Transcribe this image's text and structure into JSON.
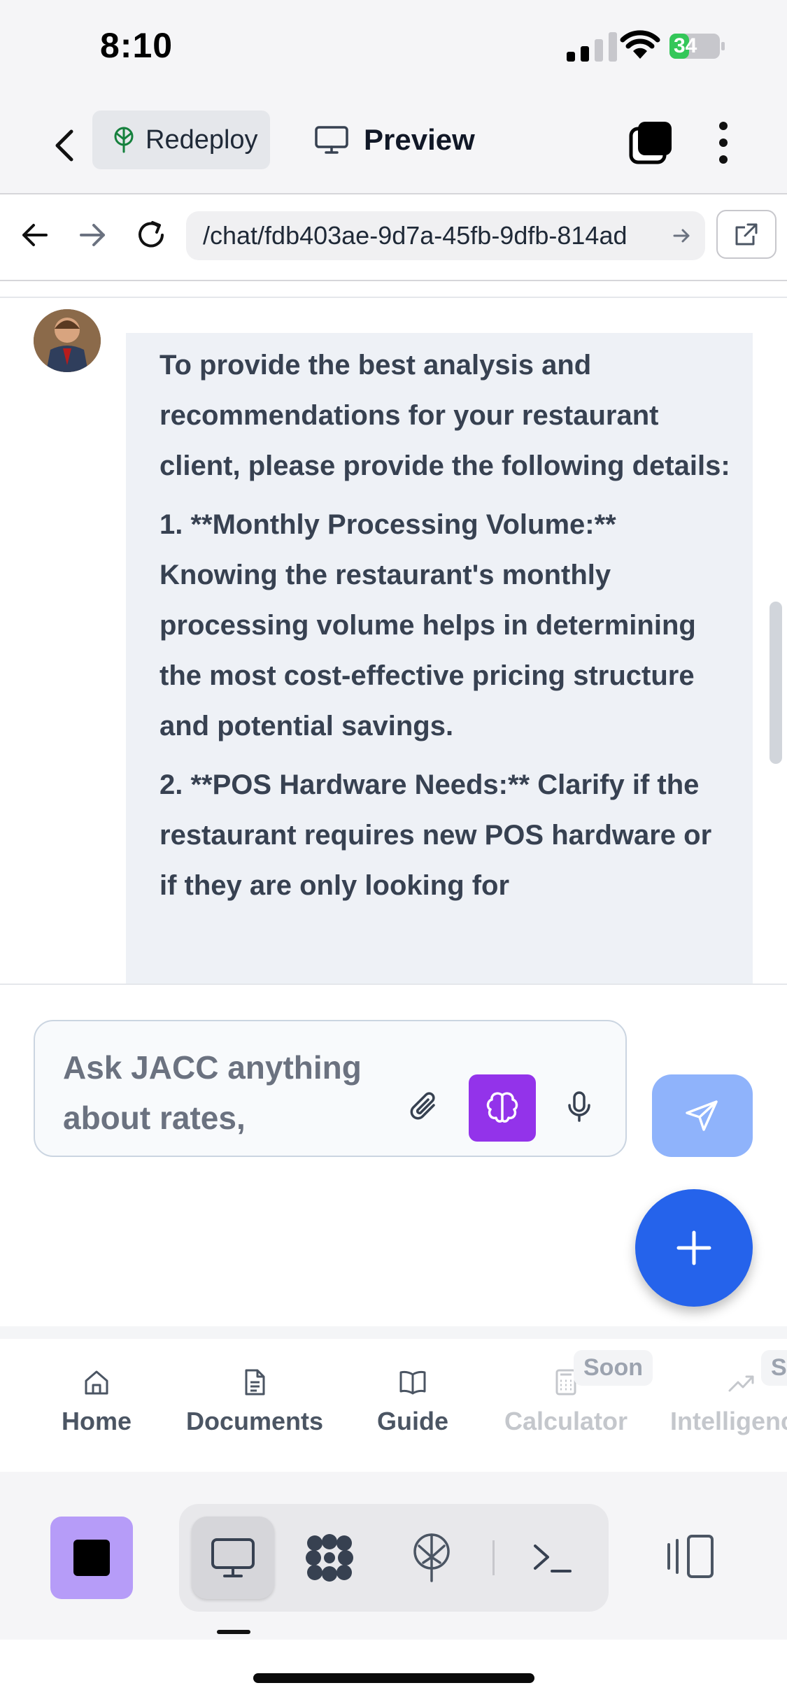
{
  "status_bar": {
    "time": "8:10",
    "battery": "34"
  },
  "app_bar": {
    "redeploy_label": "Redeploy",
    "preview_label": "Preview"
  },
  "browser": {
    "url": "/chat/fdb403ae-9d7a-45fb-9dfb-814ad"
  },
  "chat": {
    "message_paragraphs": [
      "To provide the best analysis and recommendations for your restaurant client, please provide the following details:",
      "1. **Monthly Processing Volume:** Knowing the restaurant's monthly processing volume helps in determining the most cost-effective pricing structure and potential savings.",
      "2. **POS Hardware Needs:** Clarify if the restaurant requires new POS hardware or if they are only looking for"
    ]
  },
  "composer": {
    "placeholder": "Ask JACC anything about rates, documents, or client"
  },
  "bottom_nav": {
    "items": [
      {
        "label": "Home",
        "icon": "home-icon",
        "state": "active"
      },
      {
        "label": "Documents",
        "icon": "document-icon",
        "state": "active"
      },
      {
        "label": "Guide",
        "icon": "book-icon",
        "state": "active"
      },
      {
        "label": "Calculator",
        "icon": "calculator-icon",
        "state": "disabled",
        "badge": "Soon"
      },
      {
        "label": "Intelligence",
        "icon": "trending-icon",
        "state": "disabled",
        "badge": "Soon"
      }
    ]
  },
  "colors": {
    "brain_button": "#9333ea",
    "send_button": "#8fb3fb",
    "fab": "#2563eb",
    "stop_button": "#b69cf8"
  }
}
